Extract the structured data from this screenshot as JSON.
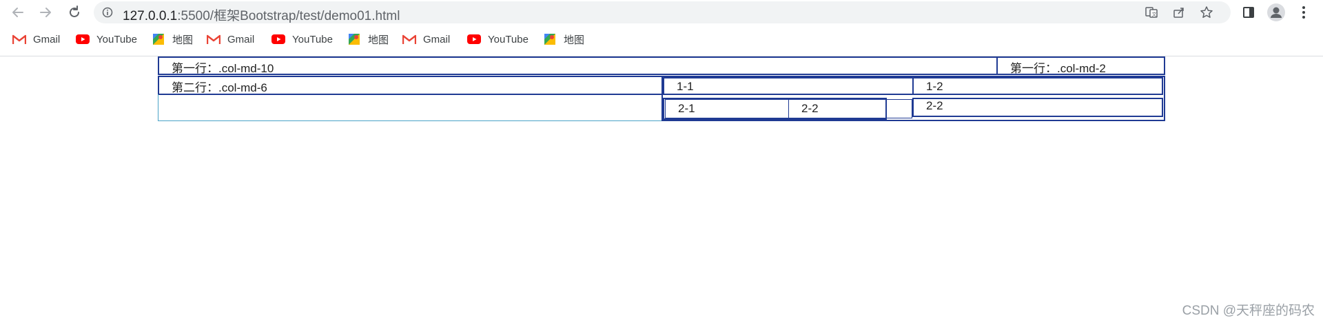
{
  "browser": {
    "url_host": "127.0.0.1",
    "url_path": ":5500/框架Bootstrap/test/demo01.html",
    "bookmarks": [
      {
        "label": "Gmail",
        "icon": "gmail-icon"
      },
      {
        "label": "YouTube",
        "icon": "youtube-icon"
      },
      {
        "label": "地图",
        "icon": "maps-icon"
      },
      {
        "label": "Gmail",
        "icon": "gmail-icon"
      },
      {
        "label": "YouTube",
        "icon": "youtube-icon"
      },
      {
        "label": "地图",
        "icon": "maps-icon"
      },
      {
        "label": "Gmail",
        "icon": "gmail-icon"
      },
      {
        "label": "YouTube",
        "icon": "youtube-icon"
      },
      {
        "label": "地图",
        "icon": "maps-icon"
      }
    ]
  },
  "grid": {
    "row1": {
      "col_a": "第一行：.col-md-10",
      "col_b": "第一行：.col-md-2"
    },
    "row2": {
      "col_left": "第二行：.col-md-6",
      "cell_1_1": "1-1",
      "cell_1_2": "1-2",
      "cell_2_1": "2-1",
      "cell_2_2a": "2-2",
      "cell_2_2b": "2-2"
    }
  },
  "watermark": "CSDN @天秤座的码农",
  "colors": {
    "border": "#1f3a93",
    "light_border": "#4aa3c7",
    "omnibox_bg": "#f1f3f4"
  }
}
